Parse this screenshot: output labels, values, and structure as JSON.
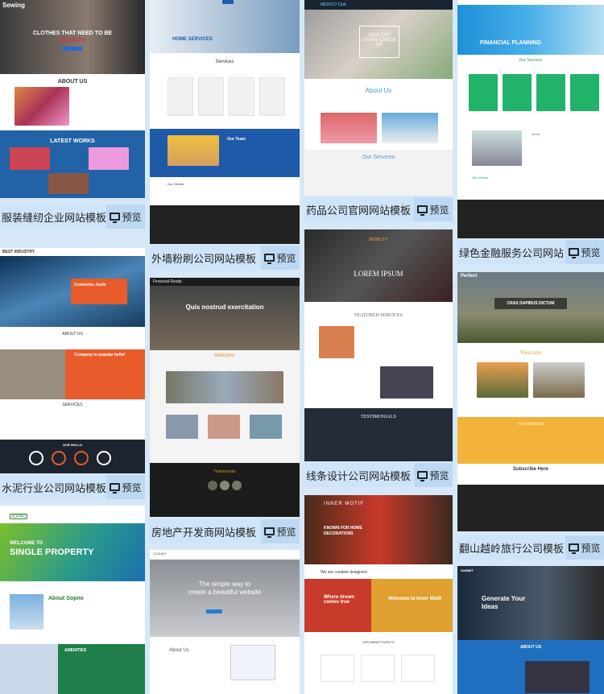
{
  "preview_label": "预览",
  "cards": [
    {
      "title": "服装缝纫企业网站模板",
      "logo": "Sewing",
      "hero": "CLOTHES THAT NEED TO BE",
      "hero2": "TAILORED",
      "s1": "ABOUT US",
      "s2": "LATEST WORKS"
    },
    {
      "title": "水泥行业公司网站模板",
      "logo": "BEST INDUSTRY",
      "hero": "Consectur Justo",
      "s1": "ABOUT US",
      "s2": "Company to popular belief",
      "s3": "SERVICES",
      "s4": "OUR SKILLS"
    },
    {
      "logo": "SOPNO",
      "hero": "WELCOME TO",
      "hero2": "SINGLE PROPERTY",
      "s1": "About Sopno",
      "s2": "AMENITIES"
    },
    {
      "title": "外墙粉刷公司网站模板",
      "hero": "HOME SERVICES",
      "s1": "Services",
      "s2": "Our Team",
      "s3": "Our Clients"
    },
    {
      "title": "房地产开发商网站模板",
      "logo": "Financial Realty",
      "hero": "Quis nostrud exercitation",
      "s1": "Welcome",
      "s2": "Testimonials"
    },
    {
      "logo": "CLOUDY",
      "hero": "The simple way to",
      "hero2": "create a beautiful website",
      "s1": "About Us"
    },
    {
      "title": "药品公司官网网站模板",
      "logo": "MEDICO Club",
      "hero": "HEALTHY LIVING CHECK UP",
      "s1": "About Us",
      "s2": "Our Services"
    },
    {
      "title": "线条设计公司网站模板",
      "logo": "MOBILITY",
      "hero": "LOREM IPSUM",
      "s1": "FEATURED SERVICES",
      "s2": "TESTIMONIALS"
    },
    {
      "logo": "INNER MOTIF",
      "hero": "KNOWN FOR HOME",
      "hero2": "DECORATIONS",
      "s1": "We are creative designers",
      "s2": "Where dream comes true",
      "s3": "Welcome to Inner Motif",
      "s4": "UPCOMING EVENTS"
    },
    {
      "title": "绿色金融服务公司网站",
      "hero": "FINANCIAL PLANNING",
      "s1": "Our Services",
      "s2": "About",
      "s3": "Our Clients"
    },
    {
      "title": "翻山越岭旅行公司模板",
      "logo": "Perfect",
      "hero": "CRAS DAPIBUS DICTUM",
      "s1": "Welcome",
      "s2": "Our Services",
      "s3": "Subscribe Here"
    },
    {
      "logo": "SUMMIT",
      "hero": "Generate Your",
      "hero2": "Ideas",
      "s1": "ABOUT US"
    }
  ]
}
